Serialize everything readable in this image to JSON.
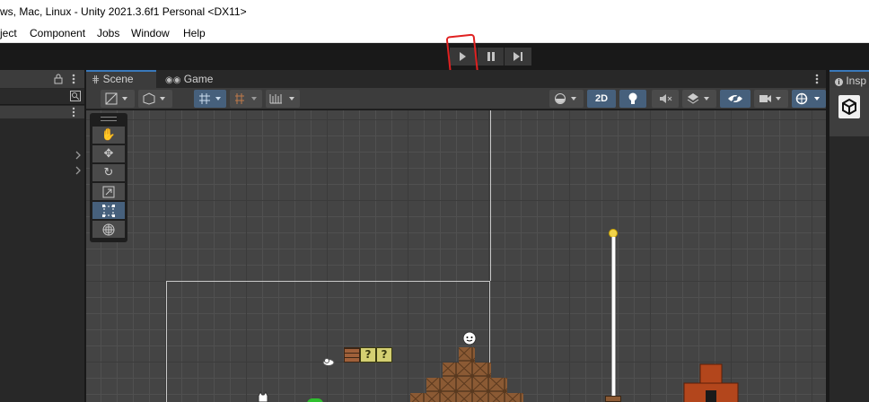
{
  "window": {
    "title": "ws, Mac, Linux - Unity 2021.3.6f1 Personal <DX11>"
  },
  "menu": [
    "ject",
    "Component",
    "Jobs",
    "Window",
    "Help"
  ],
  "tabs": {
    "scene": "Scene",
    "game": "Game",
    "inspector": "Insp"
  },
  "scene_toolbar": {
    "mode_2d": "2D"
  },
  "world": {
    "question_mark": "?"
  },
  "colors": {
    "accent": "#3a79bb",
    "highlight": "#e02020",
    "brick": "#a0603a",
    "crate": "#8b5a34"
  }
}
